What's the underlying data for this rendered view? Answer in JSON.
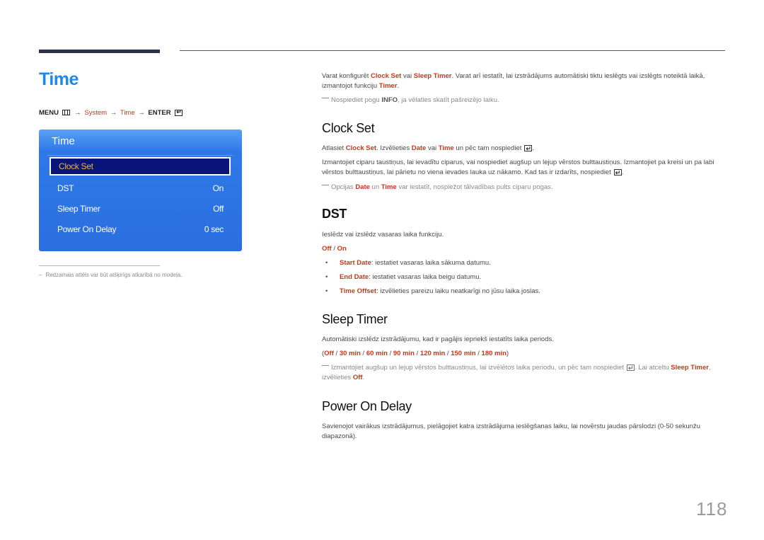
{
  "page": {
    "title": "Time",
    "page_number": "118"
  },
  "menu_path": {
    "menu": "MENU",
    "system": "System",
    "time": "Time",
    "enter": "ENTER",
    "arrow": "→"
  },
  "osd": {
    "title": "Time",
    "items": [
      {
        "label": "Clock Set",
        "value": "",
        "selected": true
      },
      {
        "label": "DST",
        "value": "On"
      },
      {
        "label": "Sleep Timer",
        "value": "Off"
      },
      {
        "label": "Power On Delay",
        "value": "0 sec"
      }
    ],
    "colors": {
      "panel": "#2f78e8",
      "selected_bg": "#08147a",
      "selected_text": "#f2b43a"
    }
  },
  "footnote": {
    "dash": "–",
    "text": "Redzamais attēls var būt atšķirīgs atkarībā no modeļa."
  },
  "intro": {
    "t1": "Varat konfigurēt ",
    "clock_set": "Clock Set",
    "t2": " vai ",
    "sleep_timer": "Sleep Timer",
    "t3": ". Varat arī iestatīt, lai izstrādājums automātiski tiktu ieslēgts vai izslēgts noteiktā laikā, izmantojot funkciju ",
    "timer": "Timer",
    "t4": ".",
    "note_t1": "Nospiediet pogu ",
    "note_info": "INFO",
    "note_t2": ", ja vēlaties skatīt pašreizējo laiku."
  },
  "clock_set": {
    "heading": "Clock Set",
    "p1_t1": "Atlasiet ",
    "p1_clock_set": "Clock Set",
    "p1_t2": ". Izvēlieties ",
    "p1_date": "Date",
    "p1_t3": " vai ",
    "p1_time": "Time",
    "p1_t4": " un pēc tam nospiediet",
    "p2": "Izmantojiet ciparu taustiņus, lai ievadītu ciparus, vai nospiediet augšup un lejup vērstos bulttaustiņus. Izmantojiet pa kreisi un pa labi vērstos bulttaustiņus, lai pārietu no viena ievades lauka uz nākamo. Kad tas ir izdarīts, nospiediet",
    "note_t1": "Opcijas ",
    "note_date": "Date",
    "note_t2": " un ",
    "note_time": "Time",
    "note_t3": " var iestatīt, nospiežot tālvadības pults ciparu pogas."
  },
  "dst": {
    "heading": "DST",
    "desc": "Ieslēdz vai izslēdz vasaras laika funkciju.",
    "opt_off": "Off",
    "opt_sep": " / ",
    "opt_on": "On",
    "bullets": [
      {
        "term": "Start Date",
        "text": ": iestatiet vasaras laika sākuma datumu."
      },
      {
        "term": "End Date",
        "text": ": iestatiet vasaras laika beigu datumu."
      },
      {
        "term": "Time Offset",
        "text": ": izvēlieties pareizu laiku neatkarīgi no jūsu laika joslas."
      }
    ],
    "bullet_char": "•"
  },
  "sleep_timer": {
    "heading": "Sleep Timer",
    "desc": "Automātiski izslēdz izstrādājumu, kad ir pagājis iepriekš iestatīts laika periods.",
    "options": [
      "Off",
      "30 min",
      "60 min",
      "90 min",
      "120 min",
      "150 min",
      "180 min"
    ],
    "note_t1": "Izmantojiet augšup un lejup vērstos bulttaustiņus, lai izvēlētos laika periodu, un pēc tam nospiediet",
    "note_t2": ". Lai atceltu ",
    "note_sleep_timer": "Sleep Timer",
    "note_t3": ", izvēlieties ",
    "note_off": "Off",
    "note_t4": "."
  },
  "power_on_delay": {
    "heading": "Power On Delay",
    "desc": "Savienojot vairākus izstrādājumus, pielāgojiet katra izstrādājuma ieslēgšanas laiku, lai novērstu jaudas pārslodzi (0-50 sekunžu diapazonā)."
  },
  "colors": {
    "accent_red": "#c8371a",
    "title_blue": "#1e87f0"
  }
}
